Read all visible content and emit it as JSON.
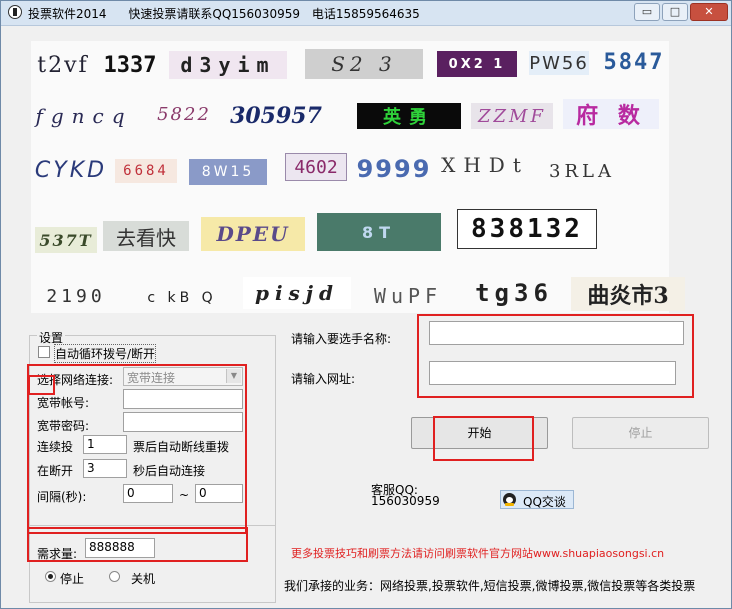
{
  "window": {
    "title": "投票软件2014",
    "contact": "快速投票请联系QQ156030959",
    "phone": "电话15859564635",
    "min_glyph": "▭",
    "max_glyph": "□",
    "close_glyph": "✕"
  },
  "captchas": [
    "t2vf",
    "1337",
    "d3yim",
    "S2 3",
    "0X2 1",
    "PW56",
    "5847",
    "fgncq",
    "5822",
    "305957",
    "英勇",
    "ZZMF",
    "府 数",
    "CYKD",
    "6684",
    "8W15",
    "4602",
    "9999",
    "XHDt",
    "3RLA",
    "537T",
    "去看快",
    "DPEU",
    "8T",
    "838132",
    "2190",
    "c kB Q",
    "pisjd",
    "WuPF",
    "tg36",
    "曲炎市3"
  ],
  "settings": {
    "group_title": "设置",
    "auto_dial_label": "自动循环拨号/断开",
    "auto_dial_checked": false,
    "network_label": "选择网络连接:",
    "network_value": "宽带连接",
    "account_label": "宽带帐号:",
    "account_value": "",
    "password_label": "宽带密码:",
    "password_value": "",
    "consecutive_label": "连续投",
    "consecutive_value": "1",
    "consecutive_suffix": "票后自动断线重拨",
    "disconnect_label": "在断开",
    "disconnect_value": "3",
    "disconnect_suffix": "秒后自动连接",
    "interval_label": "间隔(秒):",
    "interval_from": "0",
    "interval_sep": "~",
    "interval_to": "0"
  },
  "demand": {
    "label": "需求量:",
    "value": "888888"
  },
  "after_finish": {
    "stop_label": "停止",
    "shutdown_label": "关机",
    "selected": "stop"
  },
  "target": {
    "name_label": "请输入要选手名称:",
    "name_value": "",
    "url_label": "请输入网址:",
    "url_value": ""
  },
  "actions": {
    "start_label": "开始",
    "stop_label": "停止"
  },
  "support": {
    "qq_label": "客服QQ:",
    "qq_number": "156030959",
    "qq_chat_label": "QQ交谈"
  },
  "footer": {
    "promo": "更多投票技巧和刷票方法请访问刷票软件官方网站www.shuapiaosongsi.cn",
    "business": "我们承接的业务：网络投票,投票软件,短信投票,微博投票,微信投票等各类投票"
  },
  "colors": {
    "titlebar": "#d7e4f2",
    "window_bg": "#f0f0f0",
    "highlight_box": "#e02020",
    "promo_text": "#e02020",
    "close_button": "#c7503f"
  }
}
